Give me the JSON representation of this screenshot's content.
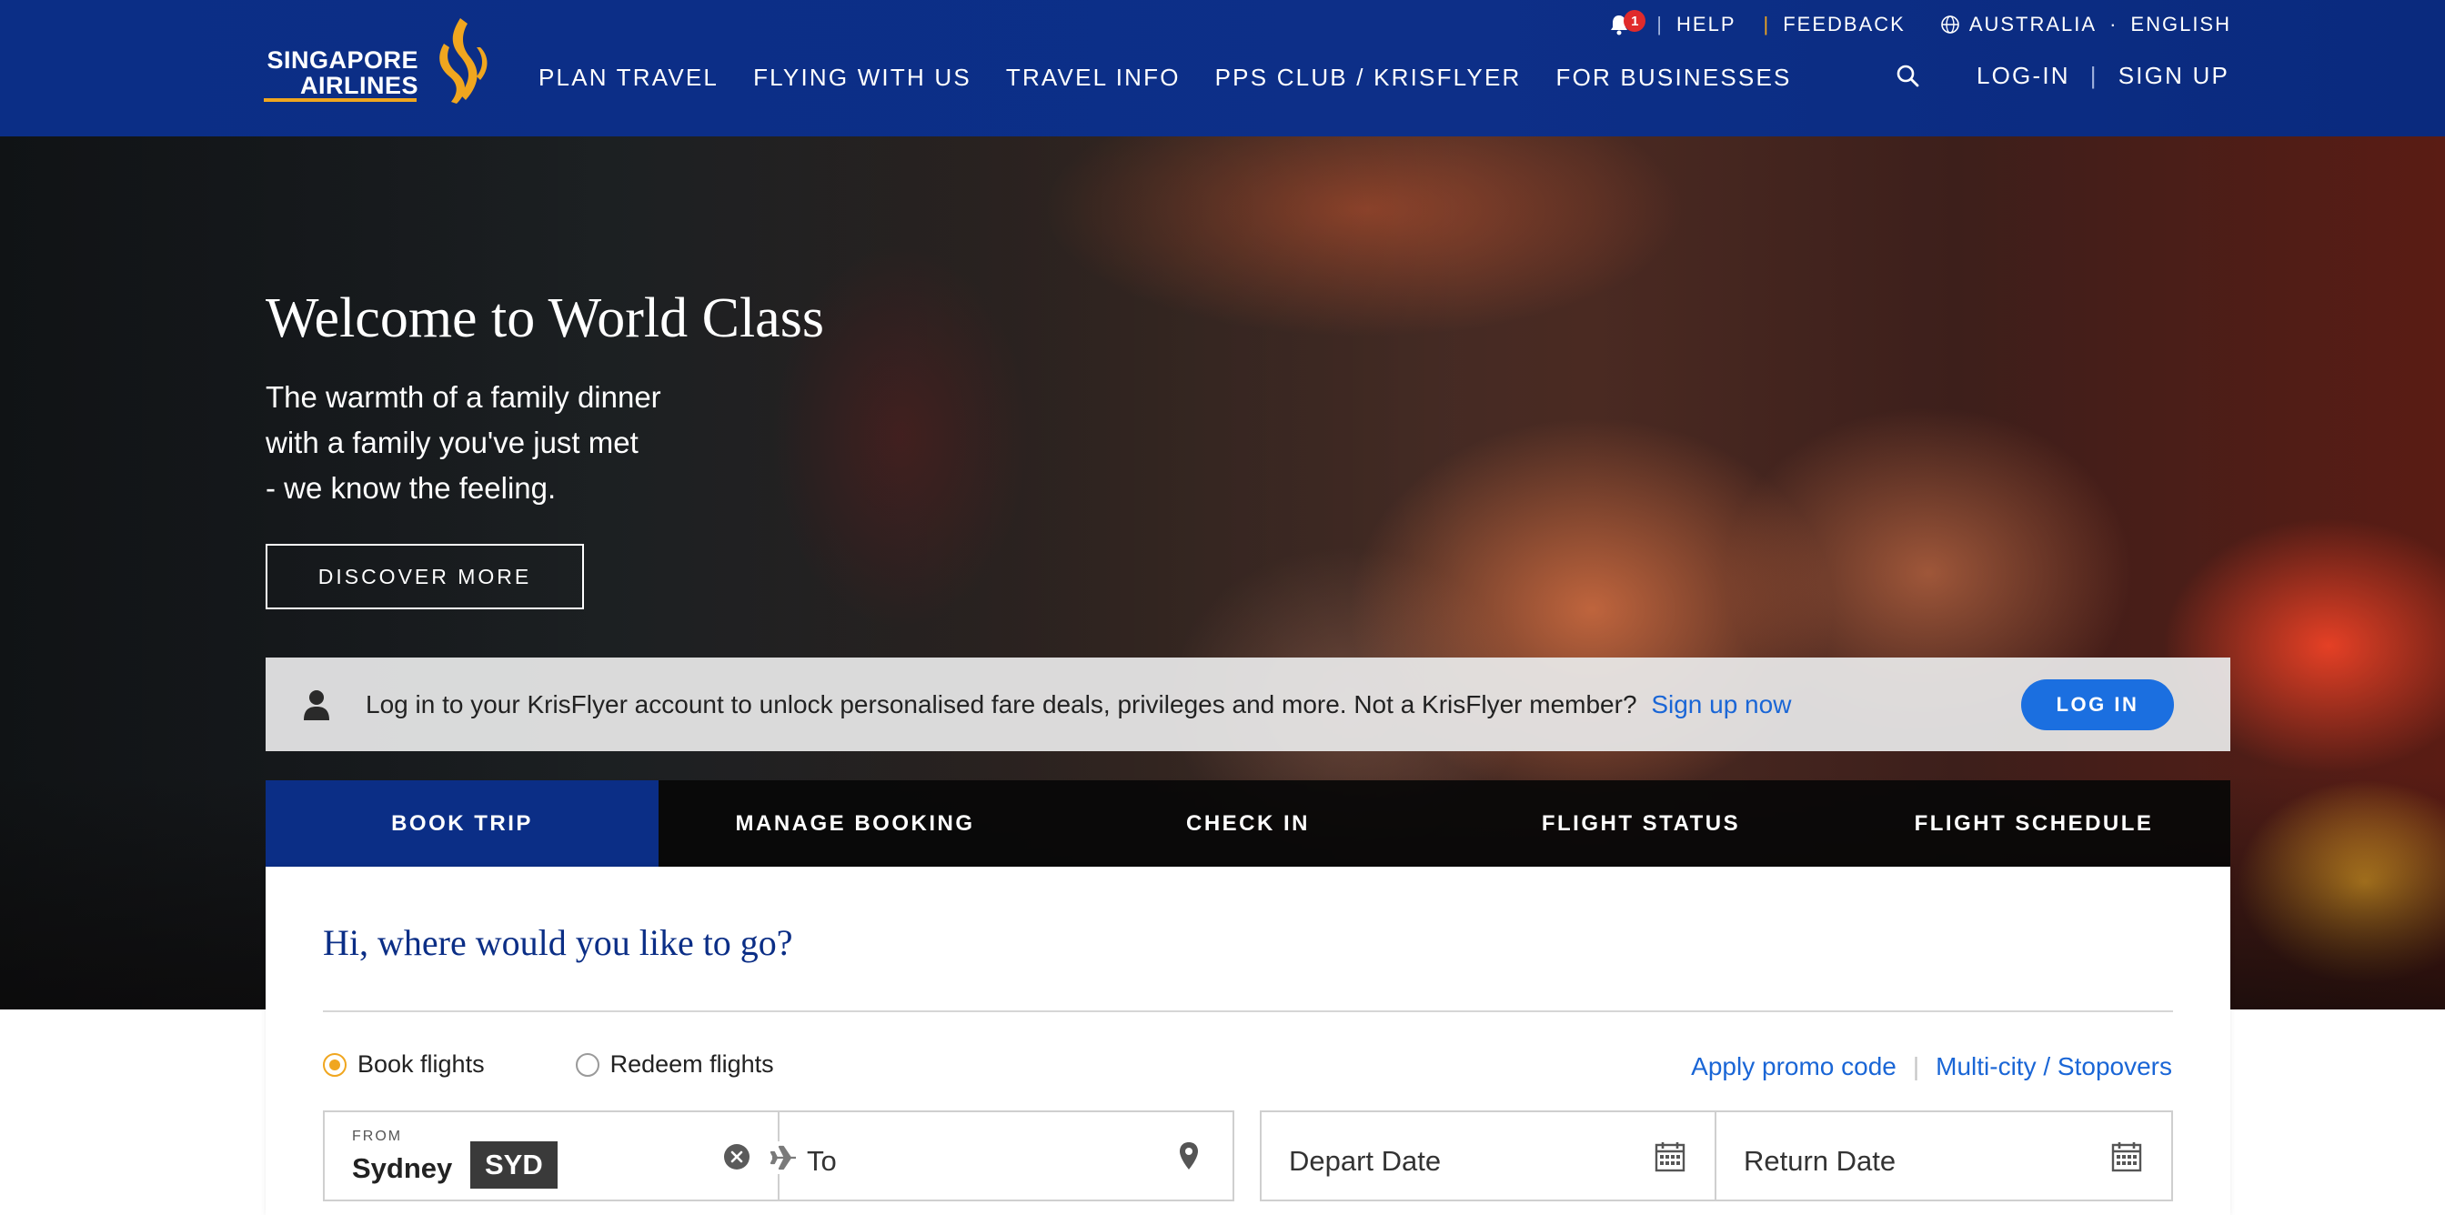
{
  "header": {
    "brand": {
      "line1": "SINGAPORE",
      "line2": "AIRLINES"
    },
    "utility": {
      "notification_count": "1",
      "help": "HELP",
      "feedback": "FEEDBACK",
      "country": "AUSTRALIA",
      "language": "ENGLISH"
    },
    "nav": [
      {
        "label": "PLAN TRAVEL"
      },
      {
        "label": "FLYING WITH US"
      },
      {
        "label": "TRAVEL INFO"
      },
      {
        "label": "PPS CLUB / KRISFLYER"
      },
      {
        "label": "FOR BUSINESSES"
      }
    ],
    "login": "LOG-IN",
    "signup": "SIGN UP"
  },
  "hero": {
    "title": "Welcome to World Class",
    "subtitle_lines": [
      "The warmth of a family dinner",
      "with a family you've just met",
      "- we know the feeling."
    ],
    "cta": "DISCOVER MORE"
  },
  "login_banner": {
    "text": "Log in to your KrisFlyer account to unlock personalised fare deals, privileges and more. Not a KrisFlyer member?",
    "link": "Sign up now",
    "button": "LOG IN"
  },
  "tabs": [
    {
      "label": "BOOK TRIP",
      "active": true
    },
    {
      "label": "MANAGE BOOKING",
      "active": false
    },
    {
      "label": "CHECK IN",
      "active": false
    },
    {
      "label": "FLIGHT STATUS",
      "active": false
    },
    {
      "label": "FLIGHT SCHEDULE",
      "active": false
    }
  ],
  "booking": {
    "title": "Hi, where would you like to go?",
    "options": [
      {
        "label": "Book flights",
        "checked": true
      },
      {
        "label": "Redeem flights",
        "checked": false
      }
    ],
    "promo": "Apply promo code",
    "multicity": "Multi-city / Stopovers",
    "from": {
      "label": "FROM",
      "city": "Sydney",
      "code": "SYD"
    },
    "to": {
      "placeholder": "To"
    },
    "depart": {
      "placeholder": "Depart Date"
    },
    "return": {
      "placeholder": "Return Date"
    }
  },
  "colors": {
    "header_bg": "#0b2e86",
    "accent_gold": "#f0a61f",
    "link_blue": "#1a66d6",
    "button_blue": "#1b6fe0",
    "badge_red": "#e02b2b"
  },
  "icons": [
    "bell-icon",
    "globe-icon",
    "search-icon",
    "person-icon",
    "clear-icon",
    "plane-icon",
    "location-pin-icon",
    "calendar-icon",
    "sia-bird-logo"
  ]
}
